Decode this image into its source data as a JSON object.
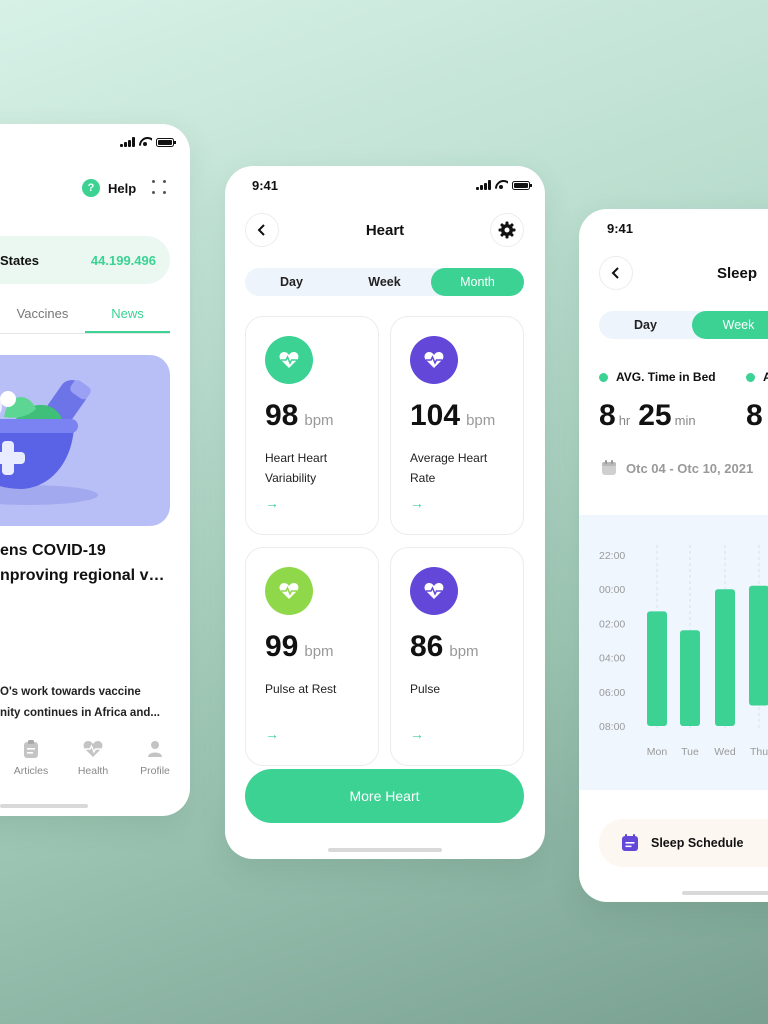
{
  "colors": {
    "accent": "#3BD293",
    "purple": "#6247D9",
    "lime": "#8FD84A",
    "chart_bg": "#EFF6FD"
  },
  "phone_news": {
    "help_label": "Help",
    "help_icon": "?",
    "stat_label": "States",
    "stat_value": "44.199.496",
    "tabs": [
      "Vaccines",
      "News"
    ],
    "active_tab": "News",
    "article_title_lines": [
      "ens COVID-19",
      "nproving regional vac..."
    ],
    "article_body_lines": [
      "O's work towards vaccine",
      "nity continues in Africa and..."
    ],
    "nav": [
      {
        "label": "Articles",
        "icon": "clipboard-icon"
      },
      {
        "label": "Health",
        "icon": "heart-pulse-icon"
      },
      {
        "label": "Profile",
        "icon": "user-icon"
      }
    ]
  },
  "phone_heart": {
    "time": "9:41",
    "title": "Heart",
    "segments": [
      "Day",
      "Week",
      "Month"
    ],
    "active_segment": "Month",
    "metrics": [
      {
        "value": "98",
        "unit": "bpm",
        "label": "Heart Heart Variability",
        "color": "#3BD293",
        "icon": "heartbeat-icon"
      },
      {
        "value": "104",
        "unit": "bpm",
        "label": "Average Heart Rate",
        "color": "#6247D9",
        "icon": "heartbeat-icon"
      },
      {
        "value": "99",
        "unit": "bpm",
        "label": "Pulse at Rest",
        "color": "#8FD84A",
        "icon": "heartbeat-icon"
      },
      {
        "value": "86",
        "unit": "bpm",
        "label": "Pulse",
        "color": "#6247D9",
        "icon": "heartbeat-icon"
      }
    ],
    "arrow": "→",
    "cta": "More Heart"
  },
  "phone_sleep": {
    "time": "9:41",
    "title": "Sleep",
    "segments": [
      "Day",
      "Week"
    ],
    "active_segment": "Week",
    "stat1_label": "AVG. Time in Bed",
    "stat1_hr": "8",
    "stat1_hr_unit": "hr",
    "stat1_min": "25",
    "stat1_min_unit": "min",
    "stat2_label": "A",
    "stat2_value": "8",
    "date_range": "Otc 04 - Otc 10, 2021",
    "schedule_label": "Sleep Schedule"
  },
  "chart_data": {
    "type": "bar",
    "categories": [
      "Mon",
      "Tue",
      "Wed",
      "Thu"
    ],
    "y_ticks": [
      "22:00",
      "00:00",
      "02:00",
      "04:00",
      "06:00",
      "08:00"
    ],
    "series": [
      {
        "start": [
          1.3,
          2.4,
          0.0,
          -0.2
        ],
        "end": [
          8.0,
          8.0,
          8.0,
          6.8
        ]
      }
    ]
  }
}
